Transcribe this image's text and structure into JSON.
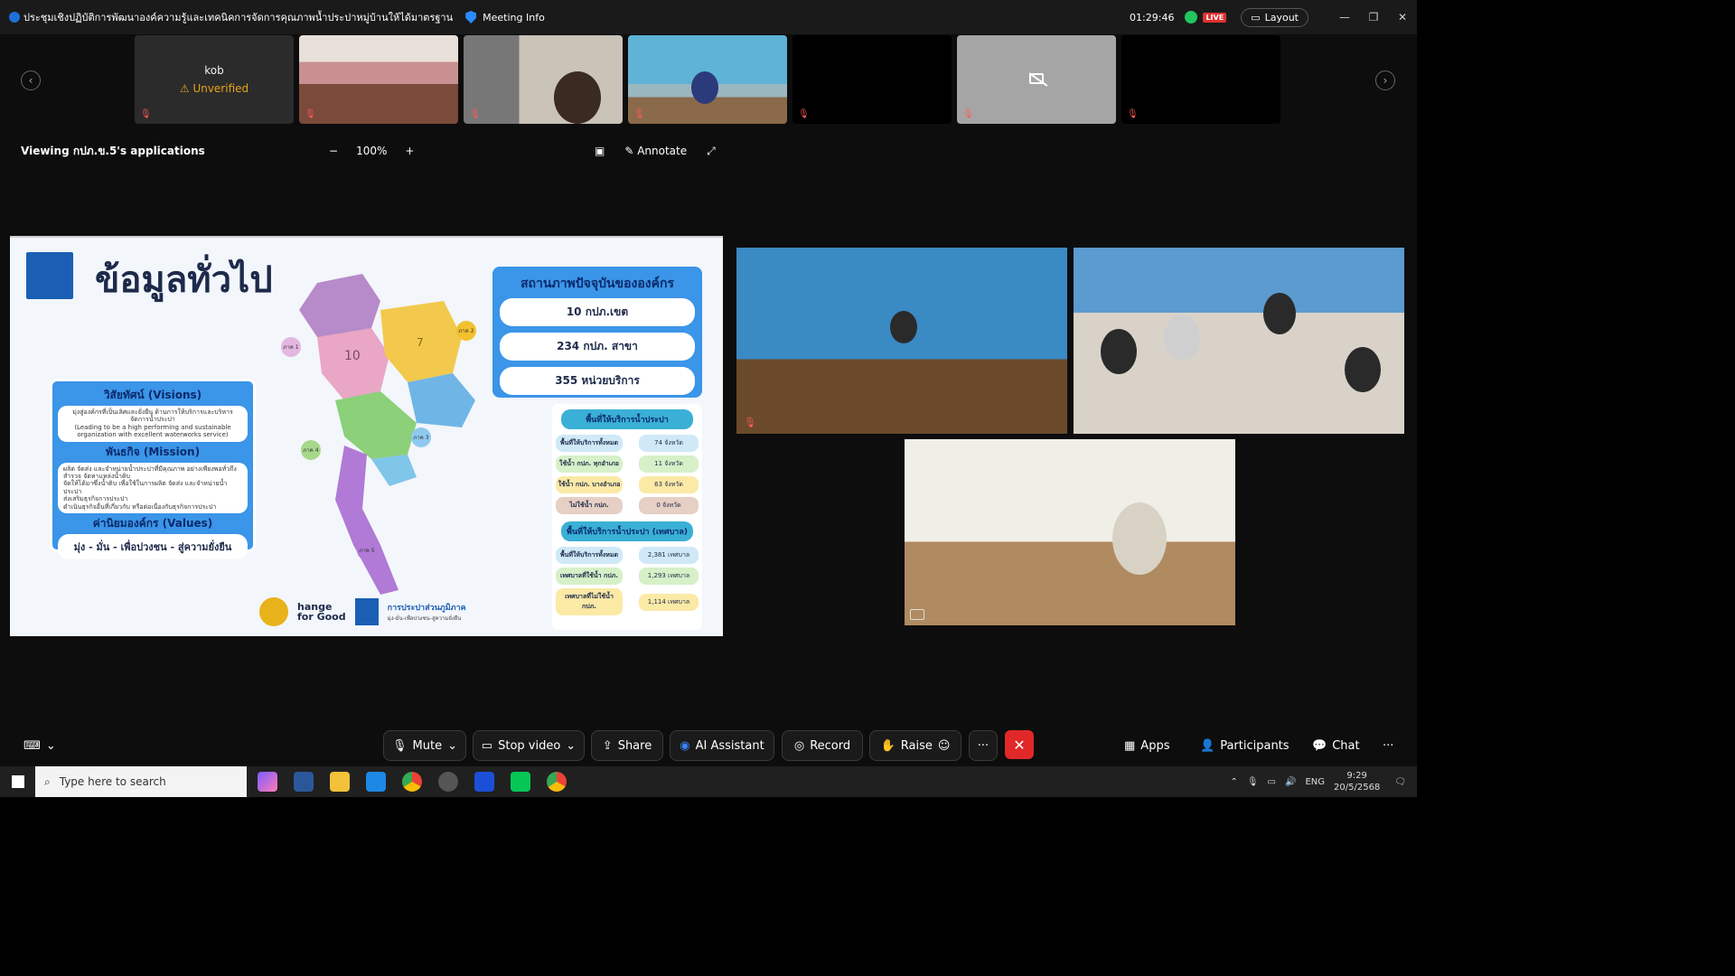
{
  "titlebar": {
    "title": "ประชุมเชิงปฏิบัติการพัฒนาองค์ความรู้และเทคนิคการจัดการคุณภาพน้ำประปาหมู่บ้านให้ได้มาตรฐาน",
    "meeting_info": "Meeting Info",
    "timer": "01:29:46",
    "live": "LIVE",
    "layout": "Layout"
  },
  "strip": {
    "kob_name": "kob",
    "kob_status": "Unverified"
  },
  "viewbar": {
    "viewing": "Viewing กปภ.ข.5's applications",
    "zoom": "100%",
    "annotate": "Annotate"
  },
  "slide": {
    "title": "ข้อมูลทั่วไป",
    "vision_head": "วิสัยทัศน์ (Visions)",
    "vision_text": "มุ่งสู่องค์กรที่เป็นเลิศและยั่งยืน ด้านการให้บริการและบริหารจัดการน้ำประปา",
    "vision_en": "(Leading to be a high performing and sustainable organization with excellent waterworks service)",
    "mission_head": "พันธกิจ (Mission)",
    "mission_items": [
      "ผลิต จัดส่ง และจำหน่ายน้ำประปาที่มีคุณภาพ อย่างเพียงพอทั่วถึง",
      "สำรวจ จัดหาแหล่งน้ำดิบ",
      "จัดให้ได้มาซึ่งน้ำดิบ เพื่อใช้ในการผลิต จัดส่ง และจำหน่ายน้ำประปา",
      "ส่งเสริมธุรกิจการประปา",
      "ดำเนินธุรกิจอื่นที่เกี่ยวกับ หรือต่อเนื่องกับธุรกิจการประปา"
    ],
    "values_head": "ค่านิยมองค์กร (Values)",
    "values_text": "มุ่ง - มั่น - เพื่อปวงชน - สู่ความยั่งยืน",
    "status_head": "สถานภาพปัจจุบันขององค์กร",
    "status_items": [
      "10 กปภ.เขต",
      "234 กปภ. สาขา",
      "355 หน่วยบริการ"
    ],
    "area_head": "พื้นที่ให้บริการน้ำประปา",
    "area_rows": [
      {
        "label": "พื้นที่ให้บริการทั้งหมด",
        "value": "74 จังหวัด",
        "color": "#cfe9f7"
      },
      {
        "label": "ใช้น้ำ กปภ. ทุกอำเภอ",
        "value": "11 จังหวัด",
        "color": "#d6f0c8"
      },
      {
        "label": "ใช้น้ำ กปภ. บางอำเภอ",
        "value": "63 จังหวัด",
        "color": "#fbe9a6"
      },
      {
        "label": "ไม่ใช้น้ำ กปภ.",
        "value": "0 จังหวัด",
        "color": "#e6cfc4"
      }
    ],
    "muni_head": "พื้นที่ให้บริการน้ำประปา (เทศบาล)",
    "muni_rows": [
      {
        "label": "พื้นที่ให้บริการทั้งหมด",
        "value": "2,381 เทศบาล",
        "color": "#cfe9f7"
      },
      {
        "label": "เทศบาลที่ใช้น้ำ กปภ.",
        "value": "1,293 เทศบาล",
        "color": "#d6f0c8"
      },
      {
        "label": "เทศบาลที่ไม่ใช้น้ำ กปภ.",
        "value": "1,114 เทศบาล",
        "color": "#fbe9a6"
      }
    ],
    "cfg_line1": "hange",
    "cfg_line2": "for Good",
    "pwa_name": "การประปาส่วนภูมิภาค",
    "pwa_tag": "มุ่ง-มั่น-เพื่อปวงชน-สู่ความยั่งยืน",
    "map_labels": [
      "ภาค 1",
      "ภาค 2",
      "ภาค 3",
      "ภาค 4",
      "ภาค 5",
      "10",
      "7"
    ]
  },
  "controls": {
    "mute": "Mute",
    "stop_video": "Stop video",
    "share": "Share",
    "ai": "AI Assistant",
    "record": "Record",
    "raise": "Raise",
    "apps": "Apps",
    "participants": "Participants",
    "chat": "Chat"
  },
  "taskbar": {
    "search": "Type here to search",
    "lang": "ENG",
    "time": "9:29",
    "date": "20/5/2568"
  }
}
